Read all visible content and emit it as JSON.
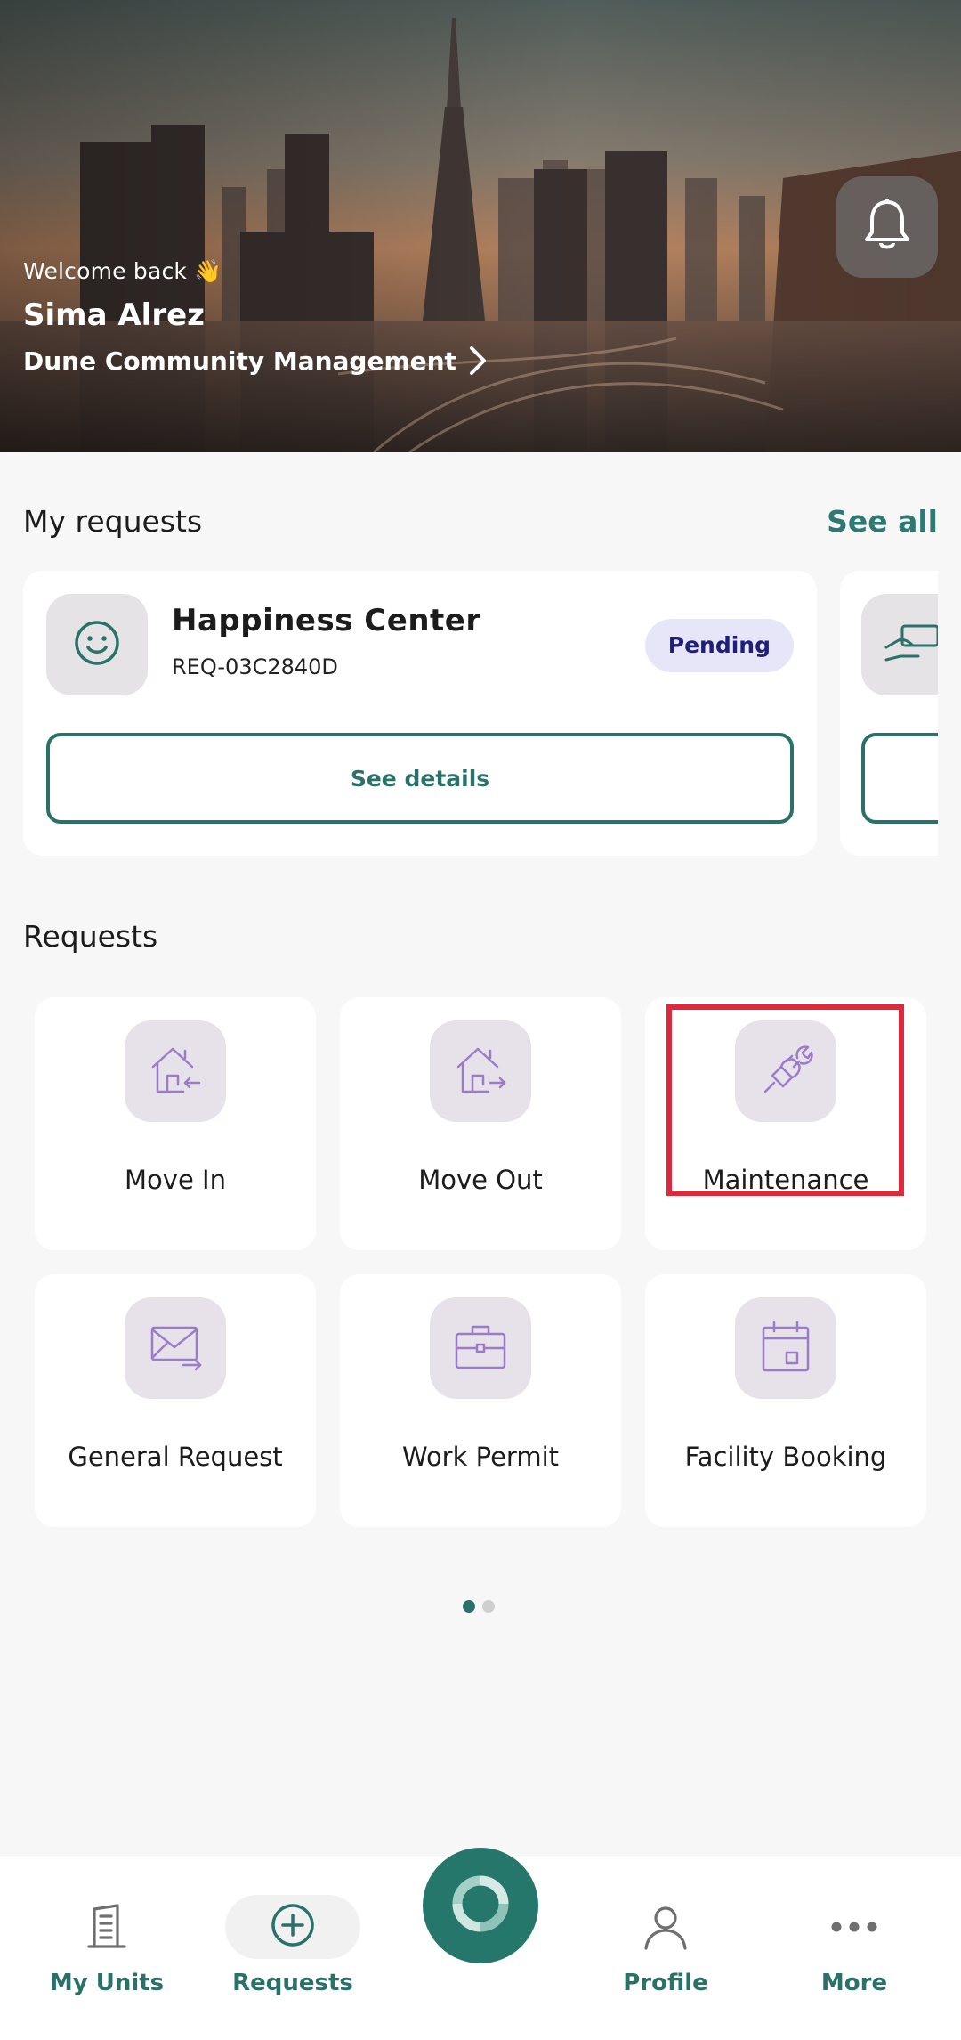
{
  "hero": {
    "welcome_text": "Welcome back 👋",
    "user_name": "Sima Alrez",
    "community": "Dune Community Management",
    "notification_icon": "bell-icon"
  },
  "my_requests": {
    "title": "My requests",
    "see_all": "See all",
    "cards": [
      {
        "icon": "smiley-icon",
        "title": "Happiness Center",
        "code": "REQ-03C2840D",
        "status": "Pending",
        "action": "See details"
      }
    ],
    "peek_icon": "hand-card-icon"
  },
  "requests": {
    "title": "Requests",
    "items": [
      {
        "label": "Move In",
        "icon": "house-move-in-icon"
      },
      {
        "label": "Move Out",
        "icon": "house-move-out-icon"
      },
      {
        "label": "Maintenance",
        "icon": "plug-wrench-icon"
      },
      {
        "label": "General Request",
        "icon": "envelope-arrow-icon"
      },
      {
        "label": "Work Permit",
        "icon": "briefcase-icon"
      },
      {
        "label": "Facility Booking",
        "icon": "calendar-icon"
      }
    ],
    "pages": 2,
    "current_page": 1
  },
  "nav": {
    "items": [
      {
        "label": "My Units",
        "icon": "building-icon"
      },
      {
        "label": "Requests",
        "icon": "plus-circle-icon"
      },
      {
        "label": "Profile",
        "icon": "person-icon"
      },
      {
        "label": "More",
        "icon": "more-dots-icon"
      }
    ],
    "center_icon": "loader-ring-icon"
  },
  "colors": {
    "accent": "#2a7269",
    "badge_bg": "#e7e6f9",
    "badge_text": "#1f1f7a",
    "icon_purple": "#9b7cc9",
    "highlight": "#e0283c"
  }
}
